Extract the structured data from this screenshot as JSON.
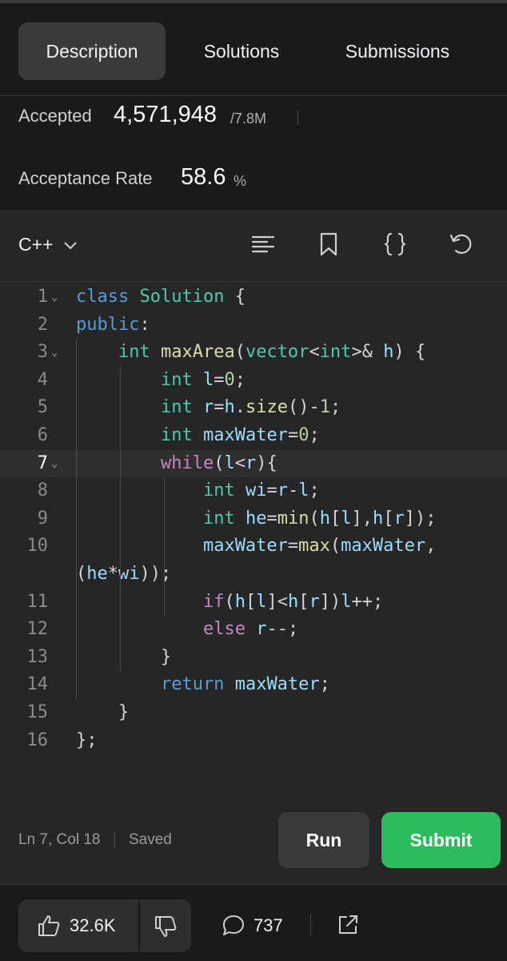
{
  "tabs": [
    {
      "label": "Description",
      "active": true
    },
    {
      "label": "Solutions",
      "active": false
    },
    {
      "label": "Submissions",
      "active": false
    }
  ],
  "stats": {
    "accepted_label": "Accepted",
    "accepted_value": "4,571,948",
    "accepted_total": "/7.8M",
    "rate_label": "Acceptance Rate",
    "rate_value": "58.6",
    "rate_unit": "%"
  },
  "editor": {
    "language": "C++",
    "toolbar_icons": [
      "format-icon",
      "bookmark-icon",
      "braces-icon",
      "reset-icon"
    ],
    "active_line": 7,
    "lines": [
      {
        "num": "1",
        "fold": true,
        "text": "class Solution {"
      },
      {
        "num": "2",
        "fold": false,
        "text": "public:"
      },
      {
        "num": "3",
        "fold": true,
        "text": "    int maxArea(vector<int>& h) {"
      },
      {
        "num": "4",
        "fold": false,
        "text": "        int l=0;"
      },
      {
        "num": "5",
        "fold": false,
        "text": "        int r=h.size()-1;"
      },
      {
        "num": "6",
        "fold": false,
        "text": "        int maxWater=0;"
      },
      {
        "num": "7",
        "fold": true,
        "text": "        while(l<r){"
      },
      {
        "num": "8",
        "fold": false,
        "text": "            int wi=r-l;"
      },
      {
        "num": "9",
        "fold": false,
        "text": "            int he=min(h[l],h[r]);"
      },
      {
        "num": "10",
        "fold": false,
        "text": "            maxWater=max(maxWater,"
      },
      {
        "num": "",
        "fold": false,
        "text": "(he*wi));"
      },
      {
        "num": "11",
        "fold": false,
        "text": "            if(h[l]<h[r])l++;"
      },
      {
        "num": "12",
        "fold": false,
        "text": "            else r--;"
      },
      {
        "num": "13",
        "fold": false,
        "text": "        }"
      },
      {
        "num": "14",
        "fold": false,
        "text": "        return maxWater;"
      },
      {
        "num": "15",
        "fold": false,
        "text": "    }"
      },
      {
        "num": "16",
        "fold": false,
        "text": "};"
      }
    ],
    "status_position": "Ln 7, Col 18",
    "status_saved": "Saved",
    "run_label": "Run",
    "submit_label": "Submit"
  },
  "bottom": {
    "likes": "32.6K",
    "comments": "737"
  },
  "colors": {
    "submit": "#2cbb5d",
    "keyword": "#569cd6",
    "type": "#4ec9b0",
    "control": "#c586c0",
    "number": "#b5cea8",
    "function": "#dcdcaa",
    "variable": "#9cdcfe"
  }
}
